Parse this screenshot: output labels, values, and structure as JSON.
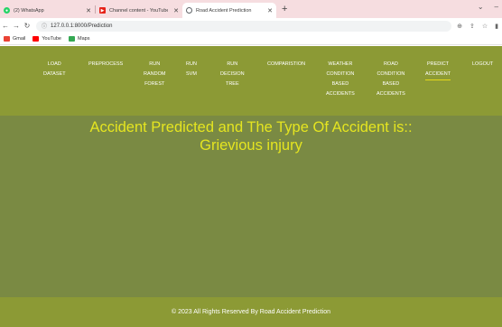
{
  "browser": {
    "tabs": [
      {
        "label": "(2) WhatsApp",
        "icon": "whatsapp-icon",
        "icon_color": "#25d366",
        "active": false
      },
      {
        "label": "Channel content - YouTube Studio",
        "icon": "youtube-studio-icon",
        "icon_color": "#e62117",
        "active": false
      },
      {
        "label": "Road Accident Prediction",
        "icon": "globe-icon",
        "icon_color": "#5f6368",
        "active": true
      }
    ],
    "new_tab": "+",
    "address": "127.0.0.1:8000/Prediction",
    "bookmarks": [
      {
        "label": "Gmail",
        "icon": "gmail-icon",
        "color": "#ea4335"
      },
      {
        "label": "YouTube",
        "icon": "youtube-icon",
        "color": "#ff0000"
      },
      {
        "label": "Maps",
        "icon": "maps-icon",
        "color": "#34a853"
      }
    ]
  },
  "nav": {
    "items": [
      {
        "lines": [
          "LOAD",
          "DATASET"
        ]
      },
      {
        "lines": [
          "PREPROCESS"
        ]
      },
      {
        "lines": [
          "RUN",
          "RANDOM",
          "FOREST"
        ]
      },
      {
        "lines": [
          "RUN",
          "SVM"
        ]
      },
      {
        "lines": [
          "RUN",
          "DECISION",
          "TREE"
        ]
      },
      {
        "lines": [
          "COMPARISTION"
        ]
      },
      {
        "lines": [
          "WEATHER",
          "CONDITION",
          "BASED",
          "ACCIDENTS"
        ]
      },
      {
        "lines": [
          "ROAD",
          "CONDITION",
          "BASED",
          "ACCIDENTS"
        ]
      },
      {
        "lines": [
          "PREDICT",
          "ACCIDENT"
        ],
        "active": true
      },
      {
        "lines": [
          "LOGOUT"
        ]
      }
    ]
  },
  "result": {
    "line1": "Accident Predicted and The Type Of Accident is::",
    "line2": "Grievious injury"
  },
  "footer": {
    "text": "© 2023 All Rights Reserved By Road Accident Prediction"
  },
  "colors": {
    "navbar": "#8c9a35",
    "content": "#7a8a43",
    "result_text": "#e5e520",
    "active_underline": "#e5d81a"
  }
}
